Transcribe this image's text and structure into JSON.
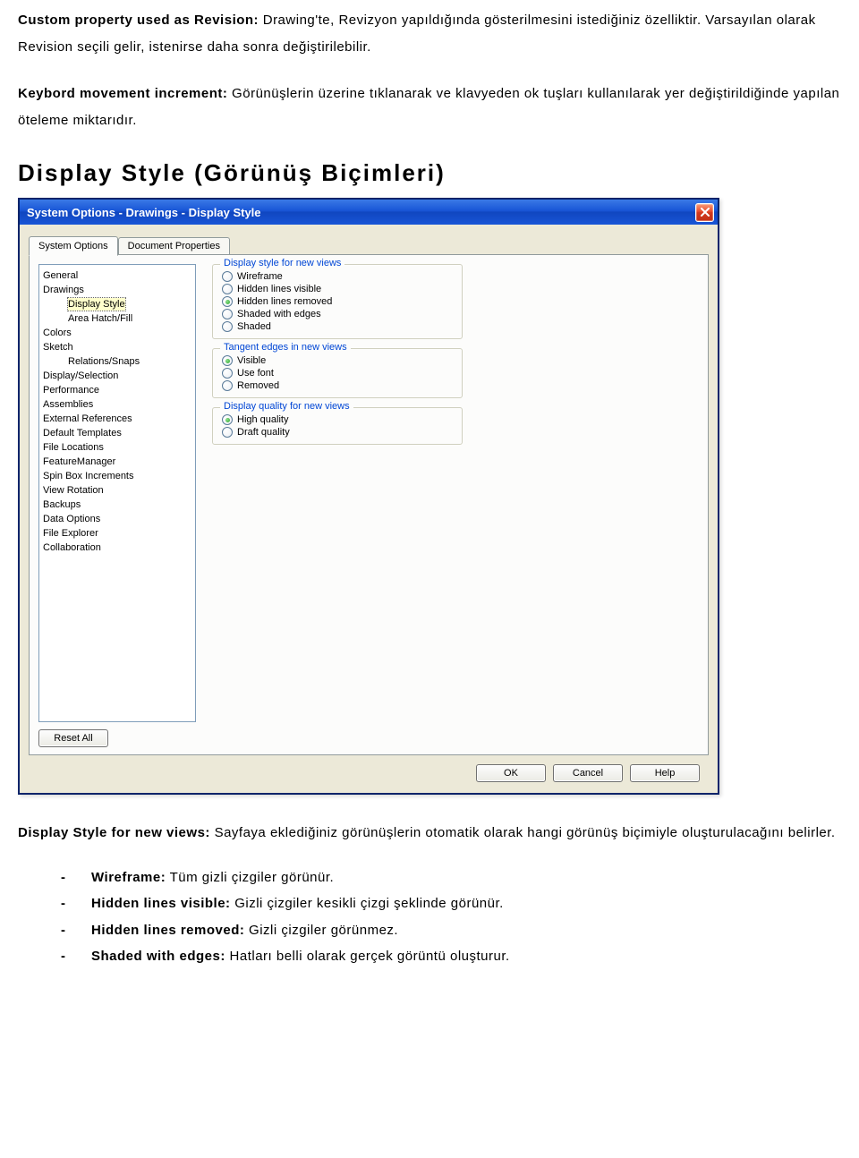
{
  "para1": {
    "lead": "Custom property used as Revision:",
    "rest": " Drawing'te, Revizyon yapıldığında gösterilmesini istediğiniz özelliktir. Varsayılan olarak Revision seçili gelir, istenirse daha sonra değiştirilebilir."
  },
  "para2": {
    "lead": "Keybord movement increment:",
    "rest": " Görünüşlerin üzerine tıklanarak ve klavyeden ok tuşları kullanılarak yer değiştirildiğinde yapılan öteleme miktarıdır."
  },
  "heading": "Display Style (Görünüş Biçimleri)",
  "dialog": {
    "title": "System Options - Drawings - Display Style",
    "tabs": {
      "sysopt": "System Options",
      "docprop": "Document Properties"
    },
    "tree": {
      "items": [
        {
          "label": "General",
          "level": 0
        },
        {
          "label": "Drawings",
          "level": 0
        },
        {
          "label": "Display Style",
          "level": 1,
          "selected": true
        },
        {
          "label": "Area Hatch/Fill",
          "level": 1
        },
        {
          "label": "Colors",
          "level": 0
        },
        {
          "label": "Sketch",
          "level": 0
        },
        {
          "label": "Relations/Snaps",
          "level": 1
        },
        {
          "label": "Display/Selection",
          "level": 0
        },
        {
          "label": "Performance",
          "level": 0
        },
        {
          "label": "Assemblies",
          "level": 0
        },
        {
          "label": "External References",
          "level": 0
        },
        {
          "label": "Default Templates",
          "level": 0
        },
        {
          "label": "File Locations",
          "level": 0
        },
        {
          "label": "FeatureManager",
          "level": 0
        },
        {
          "label": "Spin Box Increments",
          "level": 0
        },
        {
          "label": "View Rotation",
          "level": 0
        },
        {
          "label": "Backups",
          "level": 0
        },
        {
          "label": "Data Options",
          "level": 0
        },
        {
          "label": "File Explorer",
          "level": 0
        },
        {
          "label": "Collaboration",
          "level": 0
        }
      ]
    },
    "groups": {
      "g1": {
        "title": "Display style for new views",
        "options": [
          {
            "label": "Wireframe",
            "checked": false
          },
          {
            "label": "Hidden lines visible",
            "checked": false
          },
          {
            "label": "Hidden lines removed",
            "checked": true
          },
          {
            "label": "Shaded with edges",
            "checked": false
          },
          {
            "label": "Shaded",
            "checked": false
          }
        ]
      },
      "g2": {
        "title": "Tangent edges in new views",
        "options": [
          {
            "label": "Visible",
            "checked": true
          },
          {
            "label": "Use font",
            "checked": false
          },
          {
            "label": "Removed",
            "checked": false
          }
        ]
      },
      "g3": {
        "title": "Display quality for new views",
        "options": [
          {
            "label": "High quality",
            "checked": true
          },
          {
            "label": "Draft quality",
            "checked": false
          }
        ]
      }
    },
    "buttons": {
      "reset": "Reset All",
      "ok": "OK",
      "cancel": "Cancel",
      "help": "Help"
    }
  },
  "below": {
    "lead": "Display Style for new views:",
    "rest": " Sayfaya eklediğiniz görünüşlerin otomatik olarak hangi görünüş biçimiyle oluşturulacağını belirler."
  },
  "bullets": [
    {
      "lead": "Wireframe:",
      "rest": " Tüm gizli çizgiler görünür."
    },
    {
      "lead": "Hidden lines visible:",
      "rest": " Gizli çizgiler kesikli çizgi şeklinde görünür."
    },
    {
      "lead": "Hidden lines removed:",
      "rest": " Gizli çizgiler görünmez."
    },
    {
      "lead": "Shaded with edges:",
      "rest": " Hatları belli olarak gerçek görüntü oluşturur."
    }
  ]
}
